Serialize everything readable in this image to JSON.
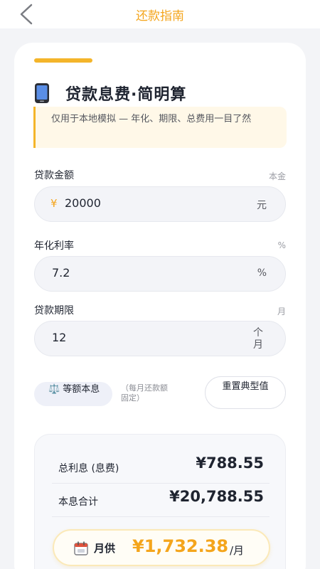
{
  "header": {
    "title": "还款指南",
    "back_icon": "chevron-left-icon"
  },
  "card": {
    "title_icon": "mobile-phone-icon",
    "title": "贷款息费·简明算",
    "note": "仅用于本地模拟 — 年化、期限、总费用一目了然"
  },
  "fields": {
    "principal": {
      "label": "贷款金额",
      "hint": "本金",
      "prefix": "¥",
      "value": "20000",
      "suffix": "元"
    },
    "rate": {
      "label": "年化利率",
      "hint": "%",
      "value": "7.2",
      "suffix": "%"
    },
    "term": {
      "label": "贷款期限",
      "hint": "月",
      "value": "12",
      "suffix_line1": "个",
      "suffix_line2": "月"
    }
  },
  "mode": {
    "icon": "⚖️",
    "label": "等额本息",
    "note": "（每月还款额固定）",
    "reset_label": "重置典型值"
  },
  "results": {
    "interest_label": "总利息 (息费)",
    "interest_value": "¥788.55",
    "total_label": "本息合计",
    "total_value": "¥20,788.55",
    "monthly_label": "月供",
    "monthly_value": "¥1,732.38",
    "monthly_unit": "/月"
  },
  "colors": {
    "accent": "#f4a51c",
    "bar": "#f4b52a"
  }
}
